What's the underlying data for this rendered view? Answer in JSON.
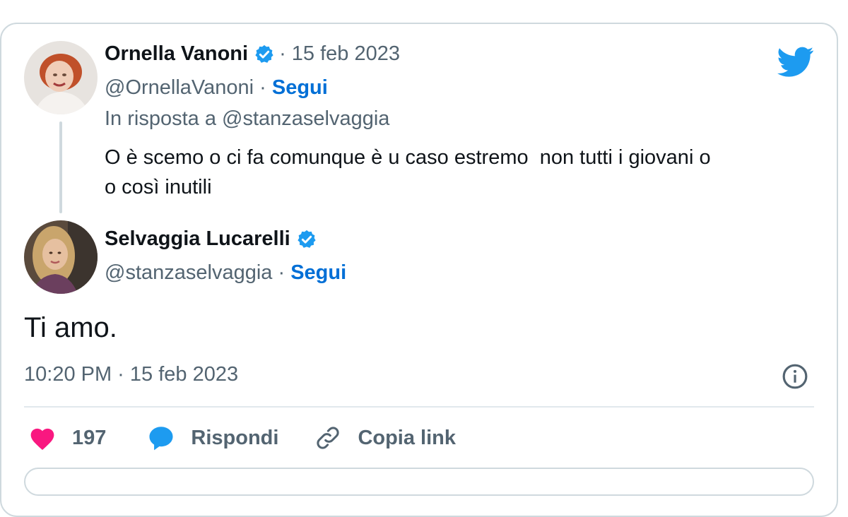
{
  "quoted_tweet": {
    "author_name": "Ornella Vanoni",
    "date": "· 15 feb 2023",
    "handle": "@OrnellaVanoni ·",
    "follow_label": "Segui",
    "reply_to": "In risposta a @stanzaselvaggia",
    "text": "O è scemo o ci fa comunque è u caso estremo  non tutti i giovani o\no così inutili"
  },
  "main_tweet": {
    "author_name": "Selvaggia Lucarelli",
    "handle": "@stanzaselvaggia ·",
    "follow_label": "Segui",
    "text": "Ti amo.",
    "timestamp": "10:20 PM · 15 feb 2023"
  },
  "actions": {
    "likes_count": "197",
    "reply_label": "Rispondi",
    "copy_link_label": "Copia link"
  },
  "colors": {
    "accent": "#1d9bf0",
    "follow": "#006fd6",
    "like": "#f91880",
    "secondary_text": "#536471",
    "border": "#cfd9de"
  },
  "icons": [
    "twitter-bird-icon",
    "verified-badge-icon",
    "info-icon",
    "heart-icon",
    "reply-bubble-icon",
    "link-icon"
  ]
}
